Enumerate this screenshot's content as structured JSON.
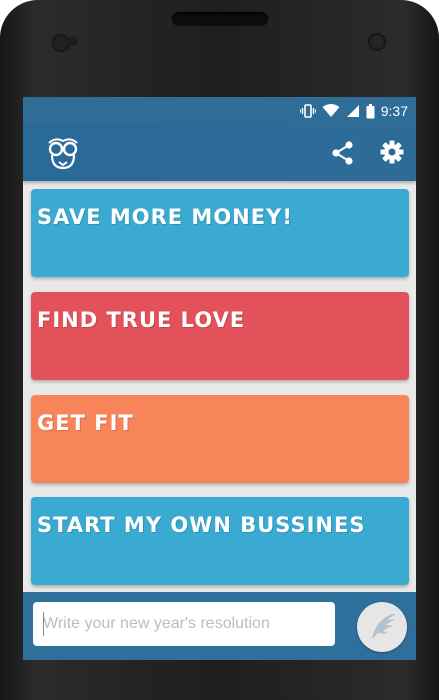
{
  "statusbar": {
    "time": "9:37",
    "icons": [
      "vibrate-icon",
      "wifi-icon",
      "signal-icon",
      "battery-icon"
    ]
  },
  "appbar": {
    "logo_icon": "nerd-glasses-icon",
    "share_icon": "share-icon",
    "settings_icon": "gear-icon"
  },
  "resolutions": [
    {
      "label": "Save more money!",
      "color": "#3aaad3"
    },
    {
      "label": "Find true love",
      "color": "#e3525a"
    },
    {
      "label": "Get fit",
      "color": "#f8845a"
    },
    {
      "label": "Start my own bussines",
      "color": "#3aaad3"
    }
  ],
  "composer": {
    "placeholder": "Write your new year's resolution",
    "value": "",
    "send_icon": "wing-icon"
  },
  "colors": {
    "primary": "#2f6f9c",
    "background": "#e9e9e9"
  }
}
